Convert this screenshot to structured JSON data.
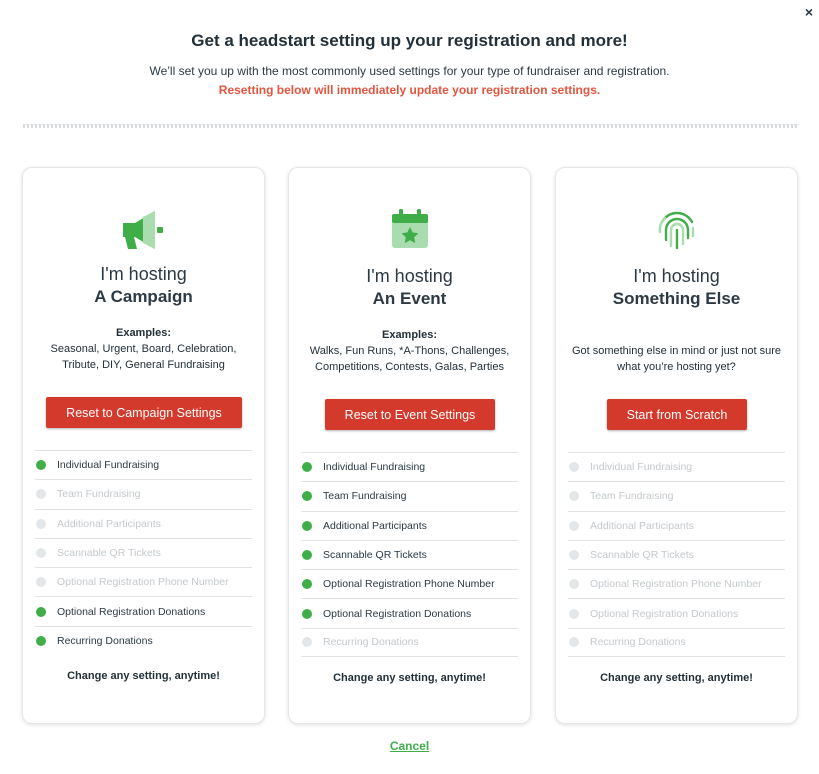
{
  "modal": {
    "close_icon": "×",
    "title": "Get a headstart setting up your registration and more!",
    "subtitle": "We’ll set you up with the most commonly used settings for your type of fundraiser and registration.",
    "warning": "Resetting below will immediately update your registration settings.",
    "cancel_label": "Cancel"
  },
  "colors": {
    "accent_green": "#3fae49",
    "button_red": "#d43a2c",
    "warning_red": "#e2553f"
  },
  "cards": [
    {
      "icon": "megaphone-icon",
      "hosting": "I'm hosting",
      "kind": "A Campaign",
      "examples_label": "Examples:",
      "examples_text": "Seasonal, Urgent, Board, Celebration, Tribute, DIY, General Fundraising",
      "button_label": "Reset to Campaign Settings",
      "features": [
        {
          "label": "Individual Fundraising",
          "enabled": true
        },
        {
          "label": "Team Fundraising",
          "enabled": false
        },
        {
          "label": "Additional Participants",
          "enabled": false
        },
        {
          "label": "Scannable QR Tickets",
          "enabled": false
        },
        {
          "label": "Optional Registration Phone Number",
          "enabled": false
        },
        {
          "label": "Optional Registration Donations",
          "enabled": true
        },
        {
          "label": "Recurring Donations",
          "enabled": true
        }
      ],
      "footer_note": "Change any setting, anytime!"
    },
    {
      "icon": "calendar-star-icon",
      "hosting": "I'm hosting",
      "kind": "An Event",
      "examples_label": "Examples:",
      "examples_text": "Walks, Fun Runs, *A-Thons, Challenges, Competitions, Contests, Galas, Parties",
      "button_label": "Reset to Event Settings",
      "features": [
        {
          "label": "Individual Fundraising",
          "enabled": true
        },
        {
          "label": "Team Fundraising",
          "enabled": true
        },
        {
          "label": "Additional Participants",
          "enabled": true
        },
        {
          "label": "Scannable QR Tickets",
          "enabled": true
        },
        {
          "label": "Optional Registration Phone Number",
          "enabled": true
        },
        {
          "label": "Optional Registration Donations",
          "enabled": true
        },
        {
          "label": "Recurring Donations",
          "enabled": false
        }
      ],
      "footer_note": "Change any setting, anytime!"
    },
    {
      "icon": "fingerprint-icon",
      "hosting": "I'm hosting",
      "kind": "Something Else",
      "examples_text": "Got something else in mind or just not sure what you’re hosting yet?",
      "button_label": "Start from Scratch",
      "features": [
        {
          "label": "Individual Fundraising",
          "enabled": false
        },
        {
          "label": "Team Fundraising",
          "enabled": false
        },
        {
          "label": "Additional Participants",
          "enabled": false
        },
        {
          "label": "Scannable QR Tickets",
          "enabled": false
        },
        {
          "label": "Optional Registration Phone Number",
          "enabled": false
        },
        {
          "label": "Optional Registration Donations",
          "enabled": false
        },
        {
          "label": "Recurring Donations",
          "enabled": false
        }
      ],
      "footer_note": "Change any setting, anytime!"
    }
  ]
}
